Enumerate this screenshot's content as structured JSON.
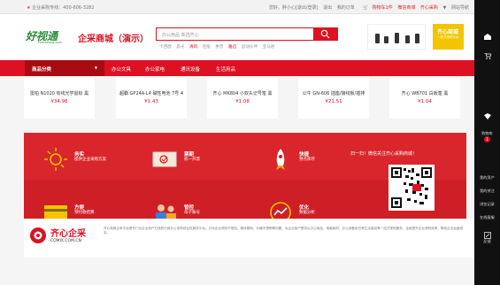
{
  "topbar": {
    "hotline_label": "企业采购专线：",
    "hotline_number": "400-606-3282",
    "links": [
      "您好，胖小心[退出/登录]",
      "退出",
      "我的订单",
      "购物车1件",
      "微信商城",
      "齐心采购",
      "▼",
      "网站导航"
    ]
  },
  "header": {
    "logo_main": "好视通",
    "logo_sub": "Fsmeeting.com",
    "mall_title": "企采商城（演示）",
    "search_placeholder": "办公用品 新选齐心",
    "hotwords": [
      "卡西欧",
      "晨光",
      "清风",
      "佳能",
      "惠普",
      "雅迅",
      "运动伙伴",
      "亚马逊"
    ],
    "banner_title": "齐心商城",
    "banner_sub": "一站式采购平台"
  },
  "nav": {
    "category_label": "商品分类",
    "items": [
      "办公文具",
      "办公家电",
      "通讯设备",
      "生活用品"
    ]
  },
  "products": [
    {
      "name": "雷柏 N1020 有线光学鼠标 黑",
      "price": "¥34.96"
    },
    {
      "name": "超霸 GP24A-L4 碱性电池 7号 4",
      "price": "¥1.43"
    },
    {
      "name": "齐心 MK804 小双头记号笔 黑",
      "price": "¥1.08"
    },
    {
      "name": "公牛 GN-606 插座/接线板/插排",
      "price": "¥21.51"
    },
    {
      "name": "齐心 WB701 白板笔 黑",
      "price": "¥1.04"
    }
  ],
  "services": [
    {
      "title": "务实",
      "sub": "提供企业采购方案"
    },
    {
      "title": "票期",
      "sub": "统一开票"
    },
    {
      "title": "快捷",
      "sub": "预点库存"
    },
    {
      "title": "方便",
      "sub": "预付款结算"
    },
    {
      "title": "管控",
      "sub": "母子账号"
    },
    {
      "title": "优化",
      "sub": "数据分析"
    }
  ],
  "qr_title": "扫一扫！微信关注齐心采购商城！",
  "footer": {
    "name": "齐心企采",
    "domain": "COMIX.COM.CN",
    "desc": "齐心商城企采平台是专门为企业用户打造的行政办公采购综合性服务平台。针对企业采购不规范、程序繁琐、价格不透明等问题，为企业用户提供从办公用品、电脑耗材、办公设备到日常生活用品等一站式采购服务，全面提升企业采购效率，降低企业运营成本。"
  },
  "right_bar": {
    "items": [
      "购物车",
      "1",
      "我的资产",
      "我的关注",
      "浏览记录",
      "在线客服",
      "反馈"
    ]
  },
  "colors": {
    "brand": "#dd1122",
    "nav_dark": "#aa0c12",
    "service_red": "#d9262c"
  }
}
